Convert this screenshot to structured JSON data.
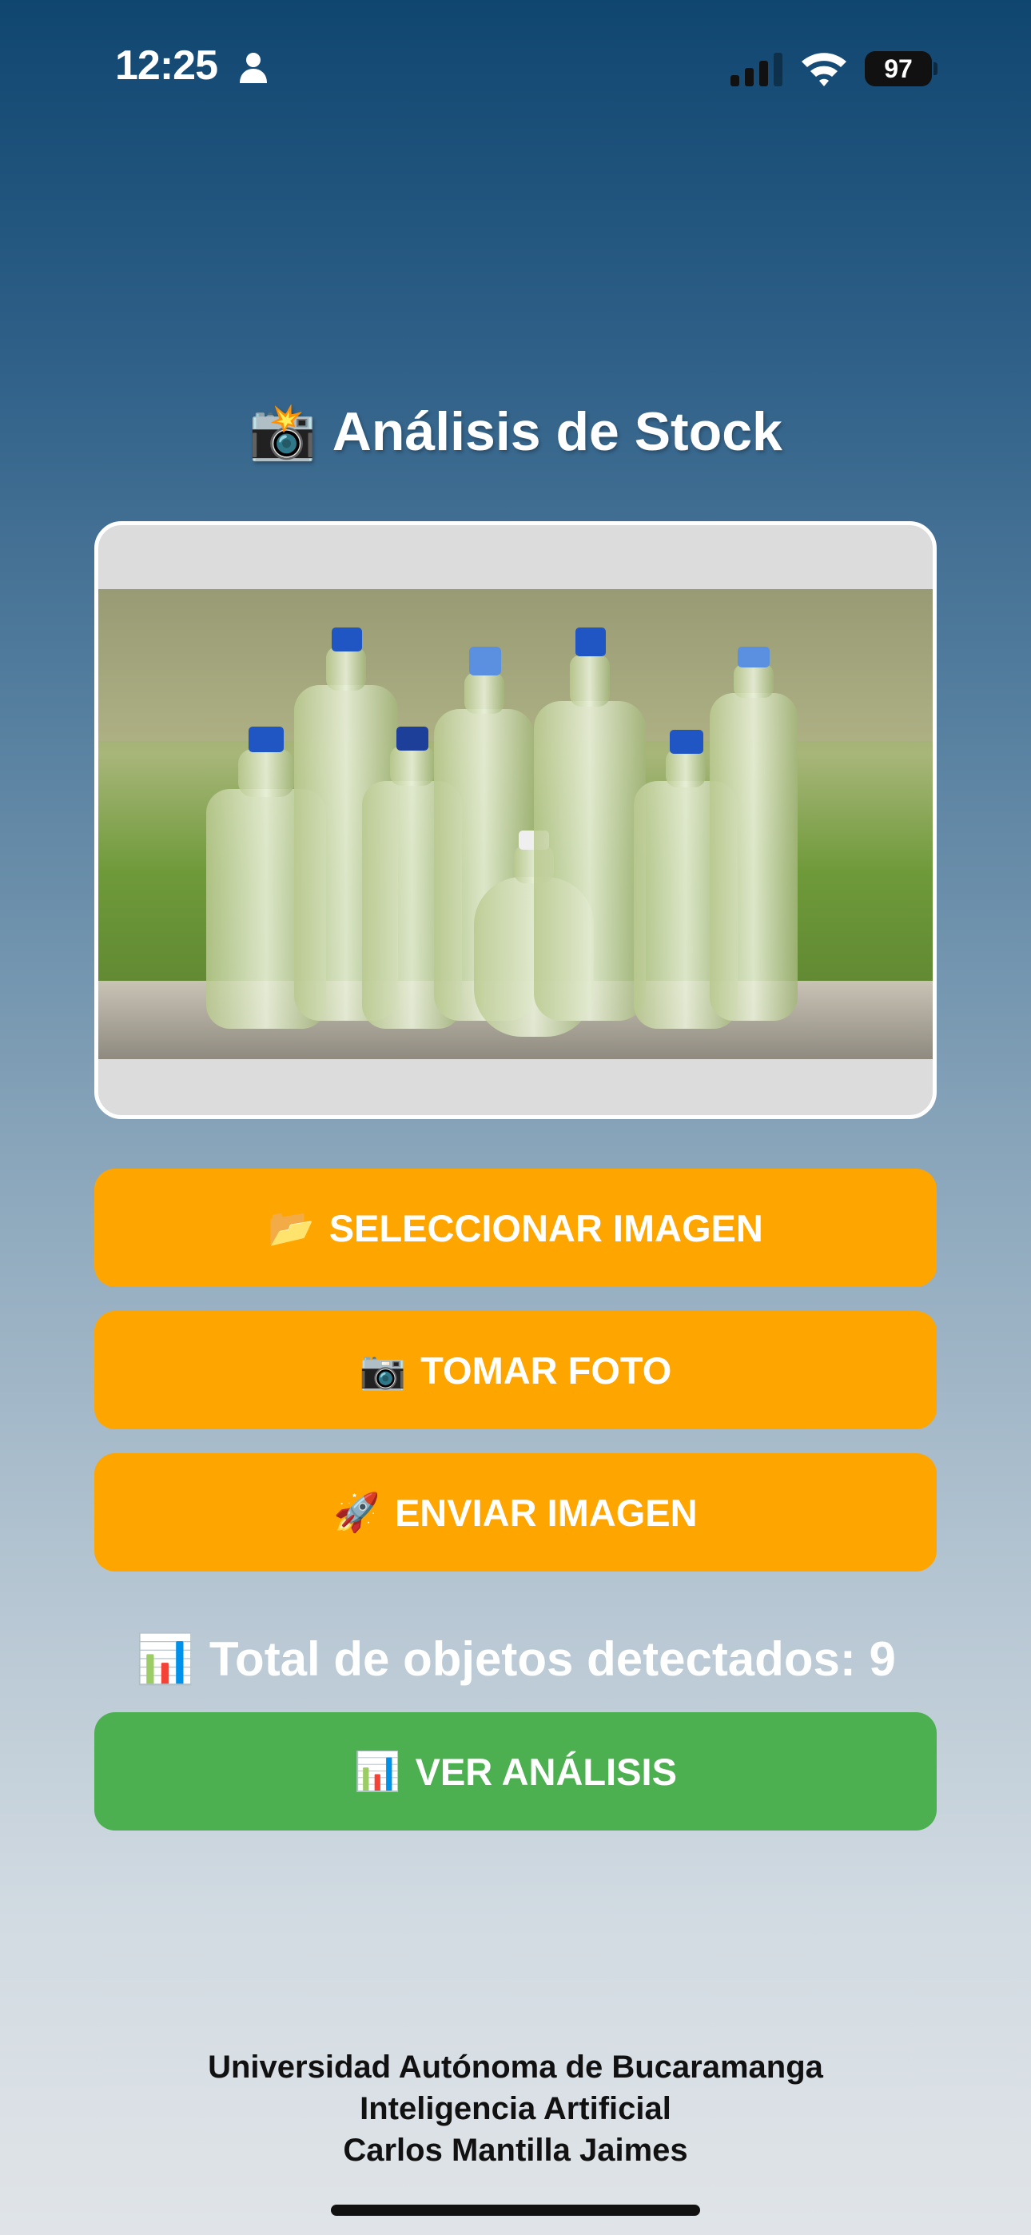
{
  "status_bar": {
    "time": "12:25",
    "battery": "97",
    "icons": [
      "person-icon",
      "signal-icon",
      "wifi-icon",
      "battery-icon"
    ]
  },
  "header": {
    "title_emoji": "📸",
    "title": "Análisis de Stock"
  },
  "image_preview": {
    "content": "photo of water bottles",
    "icon": "water-bottles-photo"
  },
  "buttons": {
    "select_image": {
      "emoji": "📂",
      "label": "SELECCIONAR IMAGEN"
    },
    "take_photo": {
      "emoji": "📷",
      "label": "TOMAR FOTO"
    },
    "send_image": {
      "emoji": "🚀",
      "label": "ENVIAR IMAGEN"
    },
    "view_analysis": {
      "emoji": "📊",
      "label": "VER ANÁLISIS"
    }
  },
  "results": {
    "emoji": "📊",
    "total_text": "Total de objetos detectados: 9"
  },
  "footer": {
    "line1": "Universidad Autónoma de Bucaramanga",
    "line2": "Inteligencia Artificial",
    "line3": "Carlos Mantilla Jaimes"
  },
  "colors": {
    "orange_button": "#ffa500",
    "green_button": "#4caf50",
    "gradient_top": "#0f4670",
    "gradient_bottom": "#e0e4e8"
  }
}
